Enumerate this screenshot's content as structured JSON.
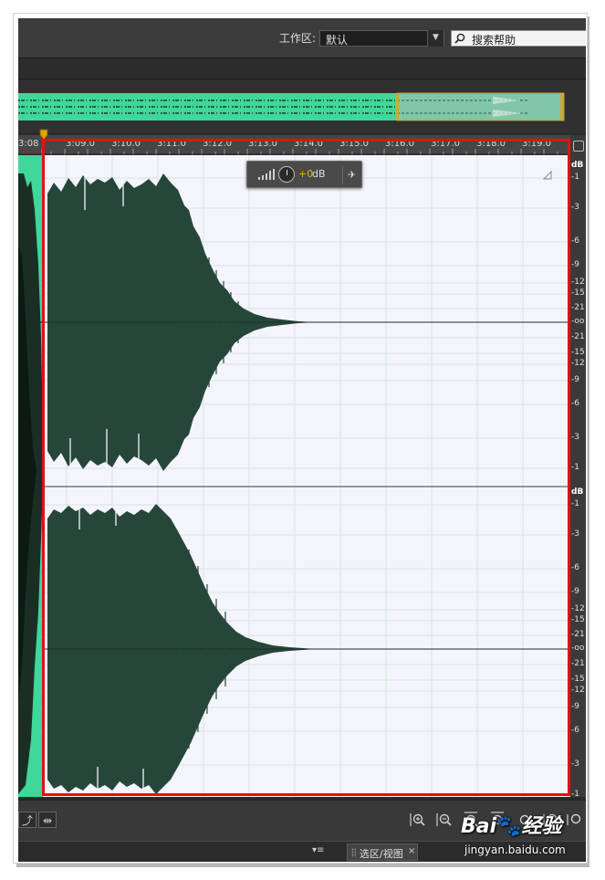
{
  "header": {
    "workspace_label": "工作区:",
    "workspace_value": "默认",
    "search_text": "搜索帮助"
  },
  "timeline": {
    "partial_start_label": "3:08",
    "tick_labels": [
      "3:09.0",
      "3:10.0",
      "3:11.0",
      "3:12.0",
      "3:13.0",
      "3:14.0",
      "3:15.0",
      "3:16.0",
      "3:17.0",
      "3:18.0",
      "3:19.0"
    ]
  },
  "gain_hud": {
    "value": "+0",
    "unit": "dB"
  },
  "amplitude_scale": {
    "unit": "dB",
    "channel_labels": [
      "-1",
      "-3",
      "-6",
      "-9",
      "-12",
      "-15",
      "-21",
      "-oo",
      "-21",
      "-15",
      "-12",
      "-9",
      "-6",
      "-3",
      "-1"
    ]
  },
  "panel": {
    "tab_label": "选区/视图",
    "tab_close": "×",
    "menu_glyph": "▾≡"
  },
  "watermark": {
    "logo": "Bai",
    "logo_suffix": "经验",
    "url": "jingyan.baidu.com"
  },
  "colors": {
    "waveform": "#26463a",
    "highlight": "#e01212",
    "overview_wave": "#3fd79a",
    "background": "#f4f4fc"
  }
}
